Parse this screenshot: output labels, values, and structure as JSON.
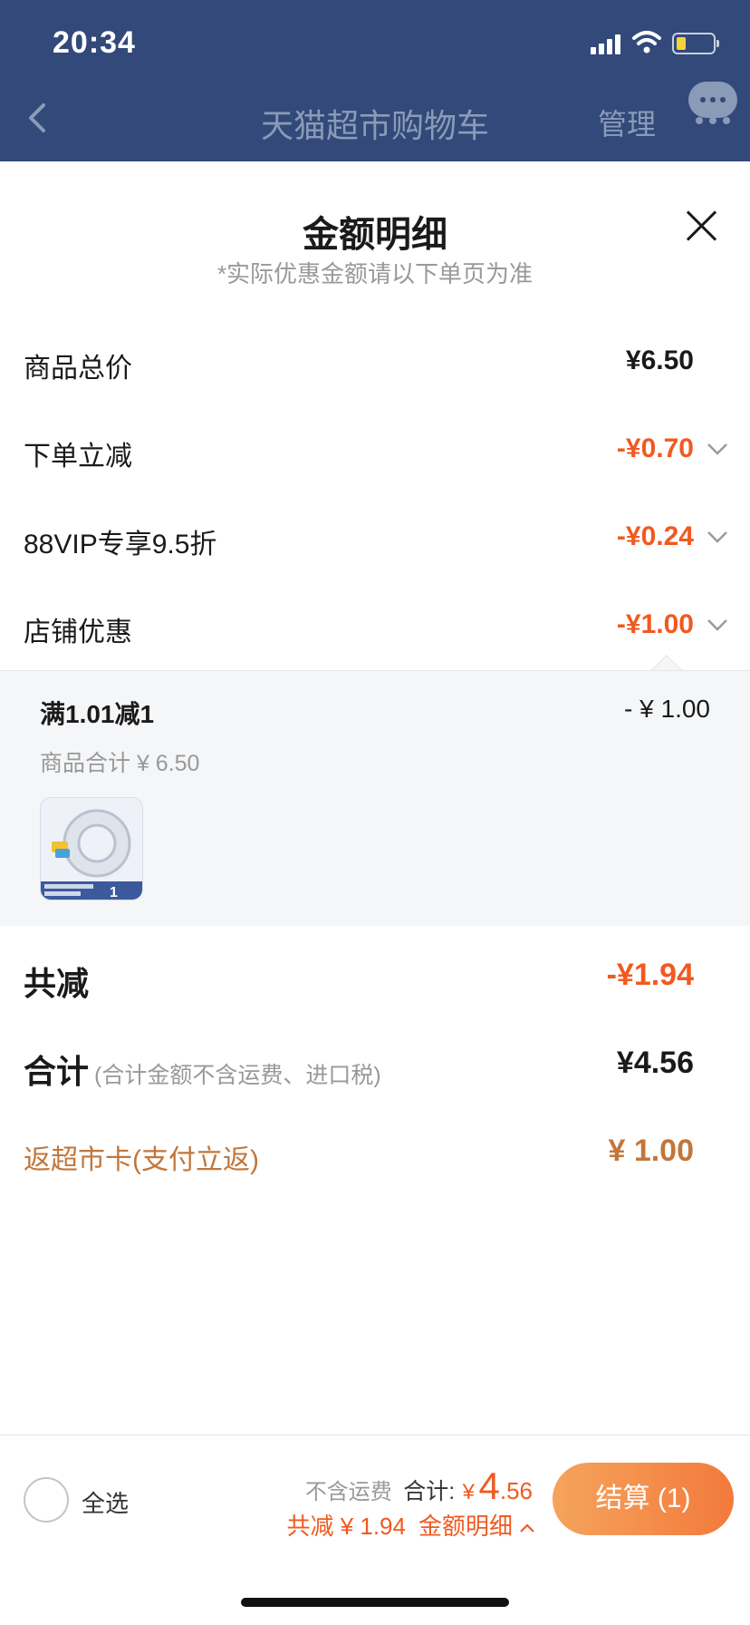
{
  "status_bar": {
    "time": "20:34"
  },
  "nav": {
    "title": "天猫超市购物车",
    "manage": "管理"
  },
  "sheet": {
    "title": "金额明细",
    "note": "*实际优惠金额请以下单页为准",
    "rows": [
      {
        "label": "商品总价",
        "amount": "¥6.50"
      },
      {
        "label": "下单立减",
        "amount": "-¥0.70"
      },
      {
        "label": "88VIP专享9.5折",
        "amount": "-¥0.24"
      },
      {
        "label": "店铺优惠",
        "amount": "-¥1.00"
      }
    ],
    "detail": {
      "rule": "满1.01减1",
      "rule_amount": "- ¥ 1.00",
      "subtotal": "商品合计 ¥ 6.50",
      "thumb_badge": "1"
    },
    "total_discount": {
      "label": "共减",
      "amount": "-¥1.94"
    },
    "total": {
      "label": "合计",
      "note": "(合计金额不含运费、进口税)",
      "amount": "¥4.56"
    },
    "rebate": {
      "label": "返超市卡(支付立返)",
      "amount": "¥ 1.00"
    }
  },
  "bottom_bar": {
    "select_all": "全选",
    "no_shipping": "不含运费",
    "total_label": "合计:",
    "currency": "¥",
    "total_int": "4",
    "total_dec": ".56",
    "discount_text": "共减 ¥ 1.94",
    "detail_link": "金额明细",
    "checkout": "结算 (1)"
  },
  "colors": {
    "header_bg": "#32497a",
    "accent_orange": "#f05a20",
    "rebate_brown": "#c2763a",
    "checkout_gradient_start": "#f5a45c",
    "checkout_gradient_end": "#f27a3c"
  },
  "icons": [
    "back-arrow-icon",
    "chat-bubble-icon",
    "close-icon",
    "chevron-down-icon",
    "chevron-up-icon",
    "signal-icon",
    "wifi-icon",
    "battery-icon"
  ]
}
